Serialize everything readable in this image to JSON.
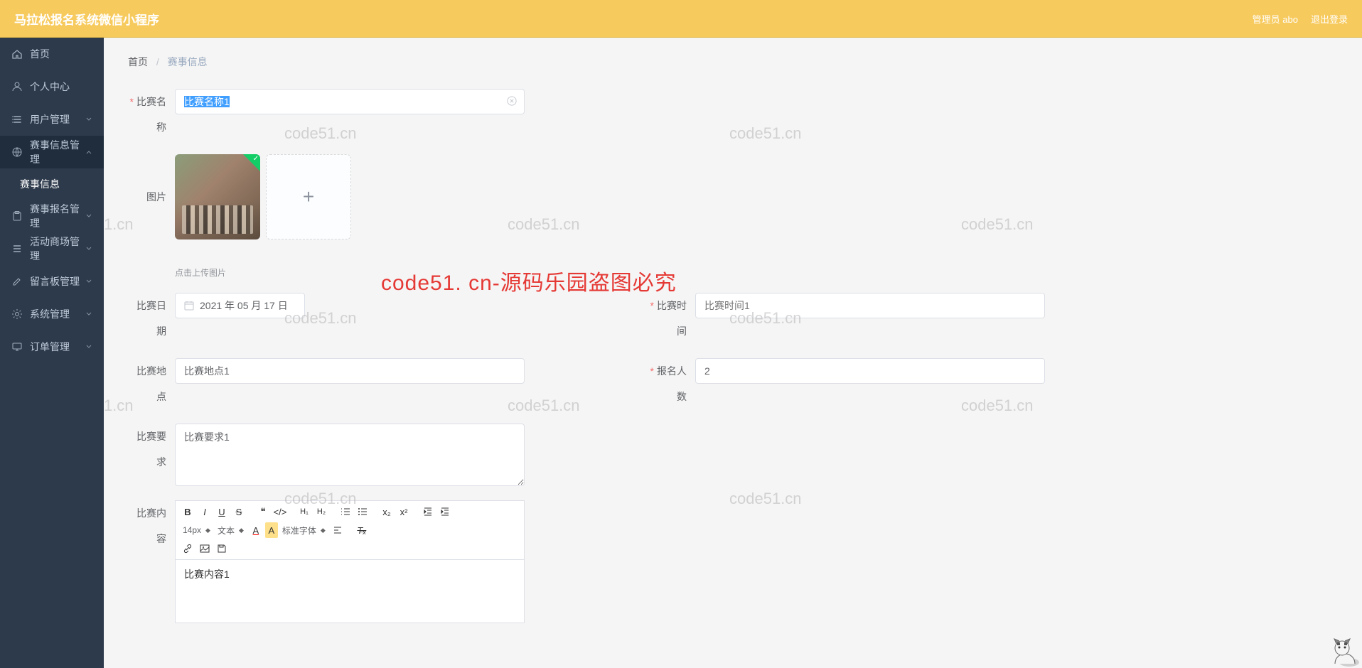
{
  "header": {
    "title": "马拉松报名系统微信小程序",
    "admin": "管理员 abo",
    "logout": "退出登录"
  },
  "sidebar": {
    "items": [
      {
        "label": "首页",
        "icon": "home",
        "expand": false
      },
      {
        "label": "个人中心",
        "icon": "user",
        "expand": false
      },
      {
        "label": "用户管理",
        "icon": "list",
        "expand": true
      },
      {
        "label": "赛事信息管理",
        "icon": "globe",
        "expand": true,
        "open": true,
        "children": [
          {
            "label": "赛事信息",
            "active": true
          }
        ]
      },
      {
        "label": "赛事报名管理",
        "icon": "clipboard",
        "expand": true
      },
      {
        "label": "活动商场管理",
        "icon": "grid",
        "expand": true
      },
      {
        "label": "留言板管理",
        "icon": "edit",
        "expand": true
      },
      {
        "label": "系统管理",
        "icon": "gear",
        "expand": true
      },
      {
        "label": "订单管理",
        "icon": "monitor",
        "expand": true
      }
    ]
  },
  "breadcrumb": {
    "home": "首页",
    "current": "赛事信息"
  },
  "form": {
    "name_label": "比赛名称",
    "name_value": "比赛名称1",
    "image_label": "图片",
    "upload_tip": "点击上传图片",
    "date_label": "比赛日期",
    "date_value": "2021 年 05 月 17 日",
    "time_label": "比赛时间",
    "time_placeholder": "比赛时间1",
    "location_label": "比赛地点",
    "location_value": "比赛地点1",
    "capacity_label": "报名人数",
    "capacity_value": "2",
    "requirement_label": "比赛要求",
    "requirement_value": "比赛要求1",
    "content_label": "比赛内容",
    "content_value": "比赛内容1"
  },
  "editor": {
    "font_size": "14px",
    "text_type": "文本",
    "font_family": "标准字体"
  },
  "watermark": {
    "text": "code51.cn",
    "red": "code51. cn-源码乐园盗图必究"
  }
}
